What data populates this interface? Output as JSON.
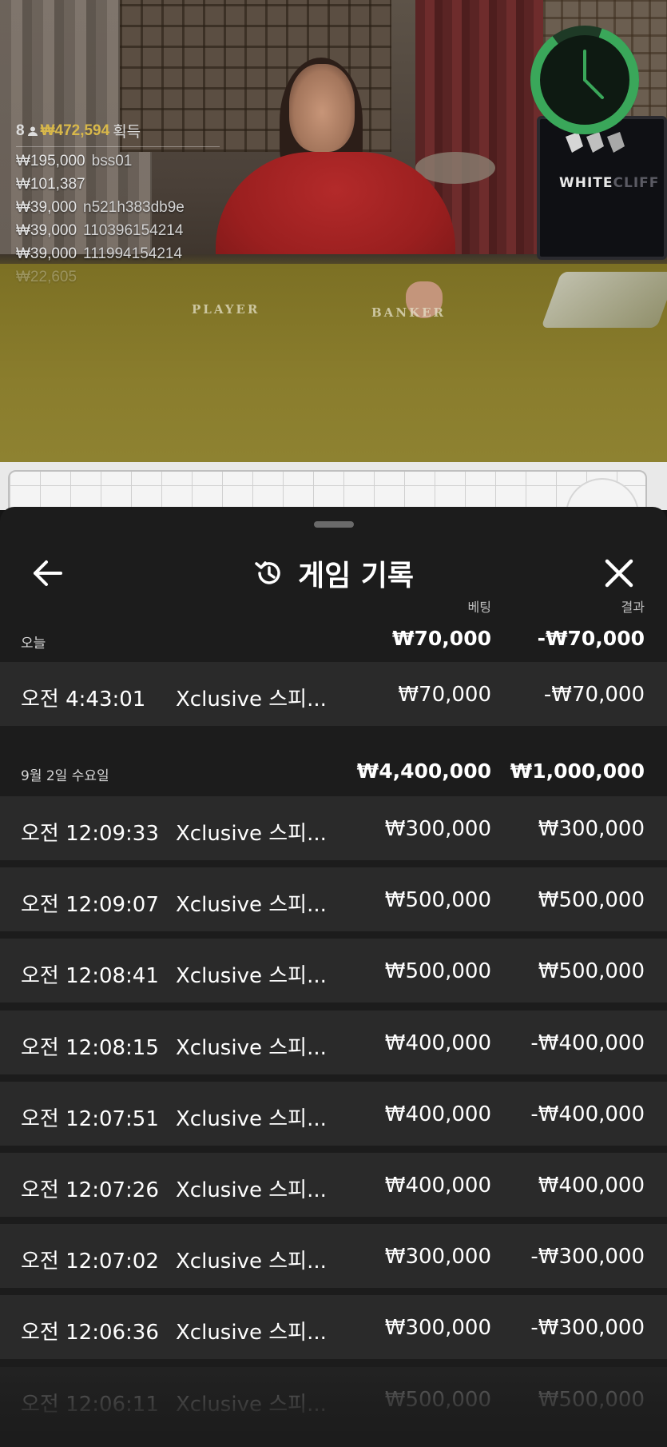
{
  "video": {
    "player_label": "PLAYER",
    "banker_label": "BANKER",
    "brand": {
      "part1": "WHITE",
      "part2": "CLIFF",
      "logo_icon": "white-cliff-logo"
    },
    "timer": {
      "icon": "clock-icon",
      "color": "#3aa75a"
    }
  },
  "winners": {
    "count": "8",
    "total": "₩472,594",
    "label": "획득",
    "rows": [
      {
        "amount": "₩195,000",
        "user": "bss01"
      },
      {
        "amount": "₩101,387",
        "user": ""
      },
      {
        "amount": "₩39,000",
        "user": "n521h383db9e"
      },
      {
        "amount": "₩39,000",
        "user": "110396154214"
      },
      {
        "amount": "₩39,000",
        "user": "111994154214"
      },
      {
        "amount": "₩22,605",
        "user": ""
      }
    ]
  },
  "sheet": {
    "title": "게임 기록",
    "back_icon": "arrow-left-icon",
    "close_icon": "close-icon",
    "title_icon": "history-icon",
    "col_bet": "베팅",
    "col_result": "결과",
    "groups": [
      {
        "date": "오늘",
        "bet_total": "₩70,000",
        "result_total": "-₩70,000",
        "rows": [
          {
            "time": "오전 4:43:01",
            "game": "Xclusive 스피...",
            "bet": "₩70,000",
            "result": "-₩70,000"
          }
        ]
      },
      {
        "date": "9월 2일 수요일",
        "bet_total": "₩4,400,000",
        "result_total": "₩1,000,000",
        "rows": [
          {
            "time": "오전 12:09:33",
            "game": "Xclusive 스피...",
            "bet": "₩300,000",
            "result": "₩300,000"
          },
          {
            "time": "오전 12:09:07",
            "game": "Xclusive 스피...",
            "bet": "₩500,000",
            "result": "₩500,000"
          },
          {
            "time": "오전 12:08:41",
            "game": "Xclusive 스피...",
            "bet": "₩500,000",
            "result": "₩500,000"
          },
          {
            "time": "오전 12:08:15",
            "game": "Xclusive 스피...",
            "bet": "₩400,000",
            "result": "-₩400,000"
          },
          {
            "time": "오전 12:07:51",
            "game": "Xclusive 스피...",
            "bet": "₩400,000",
            "result": "-₩400,000"
          },
          {
            "time": "오전 12:07:26",
            "game": "Xclusive 스피...",
            "bet": "₩400,000",
            "result": "₩400,000"
          },
          {
            "time": "오전 12:07:02",
            "game": "Xclusive 스피...",
            "bet": "₩300,000",
            "result": "-₩300,000"
          },
          {
            "time": "오전 12:06:36",
            "game": "Xclusive 스피...",
            "bet": "₩300,000",
            "result": "-₩300,000"
          },
          {
            "time": "오전 12:06:11",
            "game": "Xclusive 스피...",
            "bet": "₩500,000",
            "result": "₩500,000"
          }
        ]
      }
    ]
  }
}
